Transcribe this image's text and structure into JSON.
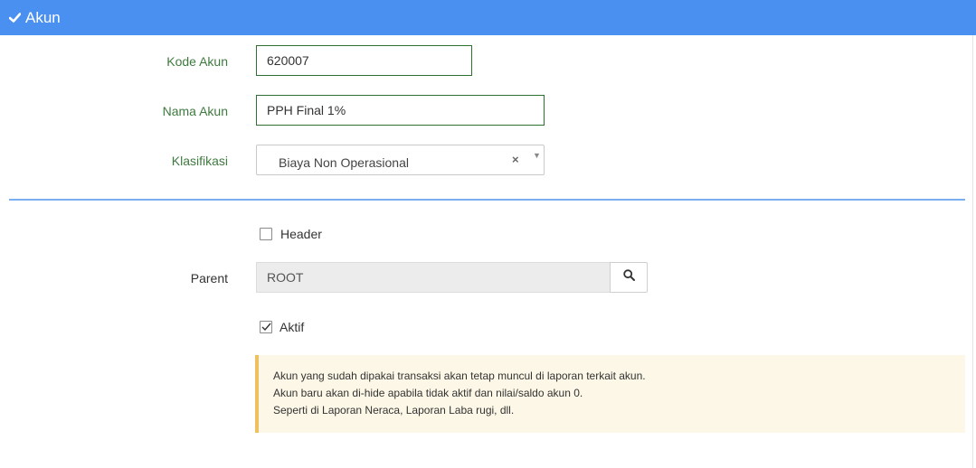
{
  "header": {
    "title": "Akun"
  },
  "form": {
    "kode_akun_label": "Kode Akun",
    "kode_akun_value": "620007",
    "nama_akun_label": "Nama Akun",
    "nama_akun_value": "PPH Final 1%",
    "klasifikasi_label": "Klasifikasi",
    "klasifikasi_value": "Biaya Non Operasional",
    "klasifikasi_clear": "×",
    "klasifikasi_arrow": "▼",
    "header_checkbox_label": "Header",
    "header_checked": false,
    "parent_label": "Parent",
    "parent_value": "ROOT",
    "aktif_checkbox_label": "Aktif",
    "aktif_checked": true
  },
  "alert": {
    "lines": [
      "Akun yang sudah dipakai transaksi akan tetap muncul di laporan terkait akun.",
      "Akun baru akan di-hide apabila tidak aktif dan nilai/saldo akun 0.",
      "Seperti di Laporan Neraca, Laporan Laba rugi, dll."
    ]
  },
  "colors": {
    "header_bg": "#4a90f0",
    "label_green": "#3f7a3f",
    "input_border": "#2f6f2f",
    "divider": "#7aaef0",
    "alert_bg": "#fcf7e6",
    "alert_border": "#f0c060"
  }
}
